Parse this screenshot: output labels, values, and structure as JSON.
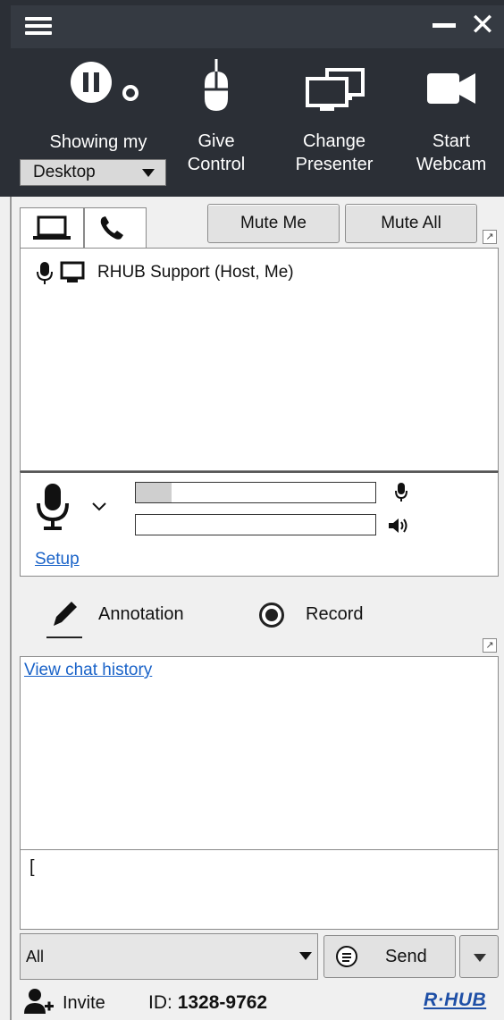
{
  "toolbar": {
    "showing_label": "Showing my",
    "showing_value": "Desktop",
    "give_control_line1": "Give",
    "give_control_line2": "Control",
    "change_presenter_line1": "Change",
    "change_presenter_line2": "Presenter",
    "start_webcam_line1": "Start",
    "start_webcam_line2": "Webcam"
  },
  "participants": {
    "mute_me_label": "Mute Me",
    "mute_all_label": "Mute All",
    "list": [
      {
        "name": "RHUB Support (Host, Me)"
      }
    ]
  },
  "audio": {
    "mic_level_fraction": 0.15,
    "speaker_level_fraction": 0.0,
    "setup_link": "Setup"
  },
  "tools": {
    "annotation_label": "Annotation",
    "record_label": "Record"
  },
  "chat": {
    "history_link": "View chat history",
    "input_value": "[",
    "recipient_value": "All",
    "send_label": "Send"
  },
  "footer": {
    "invite_label": "Invite",
    "id_prefix": "ID:",
    "meeting_id": "1328-9762",
    "brand": "R·HUB"
  }
}
